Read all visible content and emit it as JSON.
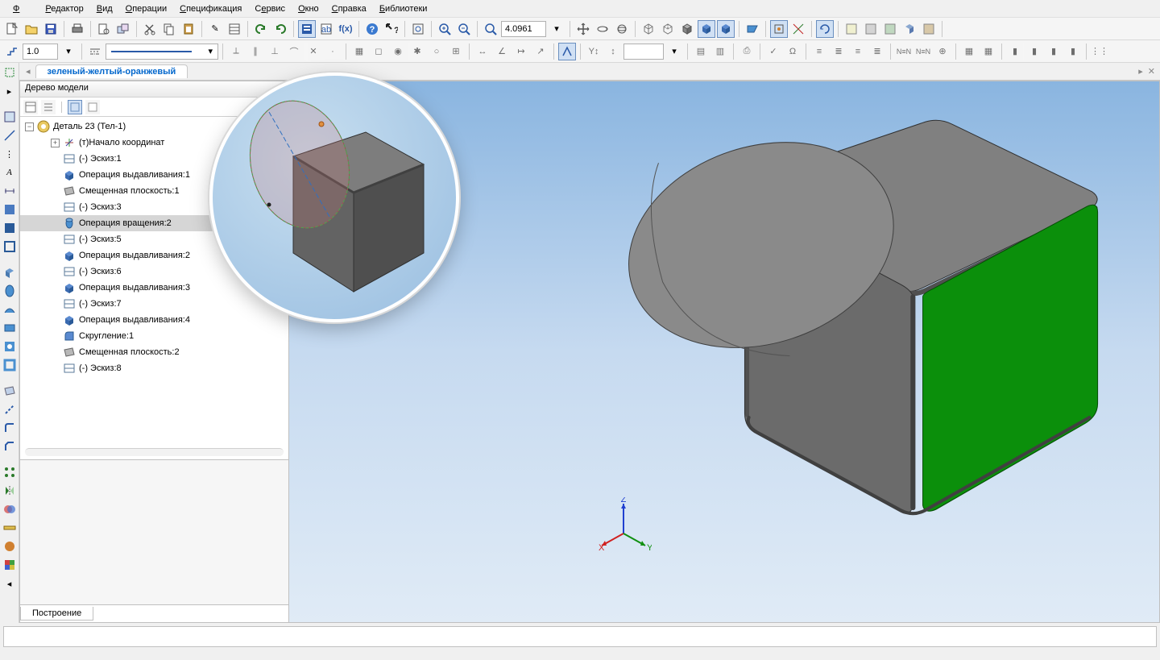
{
  "menu": [
    "Файл",
    "Редактор",
    "Вид",
    "Операции",
    "Спецификация",
    "Сервис",
    "Окно",
    "Справка",
    "Библиотеки"
  ],
  "toolbar1_input": "4.0961",
  "toolbar2_input": "1.0",
  "tab_title": "зеленый-желтый-оранжевый",
  "tree_header": "Дерево модели",
  "tree_root": "Деталь 23 (Тел-1)",
  "tree": [
    {
      "label": "(т)Начало координат",
      "indent": 1,
      "icon": "origin",
      "toggle": "+"
    },
    {
      "label": "(-) Эскиз:1",
      "indent": 1,
      "icon": "sketch"
    },
    {
      "label": "Операция выдавливания:1",
      "indent": 1,
      "icon": "extrude"
    },
    {
      "label": "Смещенная плоскость:1",
      "indent": 1,
      "icon": "plane"
    },
    {
      "label": "(-) Эскиз:3",
      "indent": 1,
      "icon": "sketch"
    },
    {
      "label": "Операция вращения:2",
      "indent": 1,
      "icon": "revolve",
      "selected": true
    },
    {
      "label": "(-) Эскиз:5",
      "indent": 1,
      "icon": "sketch"
    },
    {
      "label": "Операция выдавливания:2",
      "indent": 1,
      "icon": "extrude"
    },
    {
      "label": "(-) Эскиз:6",
      "indent": 1,
      "icon": "sketch"
    },
    {
      "label": "Операция выдавливания:3",
      "indent": 1,
      "icon": "extrude"
    },
    {
      "label": "(-) Эскиз:7",
      "indent": 1,
      "icon": "sketch"
    },
    {
      "label": "Операция выдавливания:4",
      "indent": 1,
      "icon": "extrude"
    },
    {
      "label": "Скругление:1",
      "indent": 1,
      "icon": "fillet"
    },
    {
      "label": "Смещенная плоскость:2",
      "indent": 1,
      "icon": "plane"
    },
    {
      "label": "(-) Эскиз:8",
      "indent": 1,
      "icon": "sketch"
    }
  ],
  "bottom_tab": "Построение",
  "axes": {
    "x": "X",
    "y": "Y",
    "z": "Z"
  },
  "colors": {
    "green_face": "#0b8f0b",
    "cube": "#6a6a6a",
    "cube_dark": "#565656"
  }
}
